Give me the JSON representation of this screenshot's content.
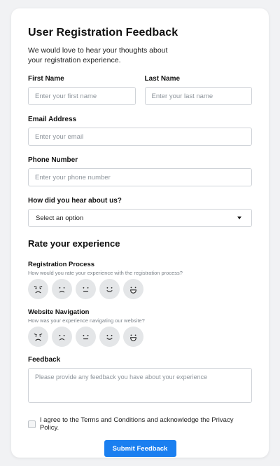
{
  "form": {
    "title": "User Registration Feedback",
    "subtitle": "We would love to hear your thoughts about your registration experience.",
    "first_name": {
      "label": "First Name",
      "placeholder": "Enter your first name",
      "value": ""
    },
    "last_name": {
      "label": "Last Name",
      "placeholder": "Enter your last name",
      "value": ""
    },
    "email": {
      "label": "Email Address",
      "placeholder": "Enter your email",
      "value": ""
    },
    "phone": {
      "label": "Phone Number",
      "placeholder": "Enter your phone number",
      "value": ""
    },
    "source": {
      "label": "How did you hear about us?",
      "selected": "Select an option"
    },
    "rate_title": "Rate your experience",
    "ratings": [
      {
        "label": "Registration Process",
        "help": "How would you rate your experience with the registration process?"
      },
      {
        "label": "Website Navigation",
        "help": "How was your experience navigating our website?"
      }
    ],
    "face_icons": [
      "angry-face-icon",
      "sad-face-icon",
      "neutral-face-icon",
      "smile-face-icon",
      "grin-face-icon"
    ],
    "feedback": {
      "label": "Feedback",
      "placeholder": "Please provide any feedback you have about your experience",
      "value": ""
    },
    "agree_text": "I agree to the Terms and Conditions and acknowledge the Privacy Policy.",
    "agree_checked": false,
    "submit_label": "Submit Feedback"
  },
  "colors": {
    "page_bg": "#f1f2f4",
    "accent": "#1a7ff0",
    "face_bg": "#e4e6e8",
    "border": "#cfd3d8"
  }
}
